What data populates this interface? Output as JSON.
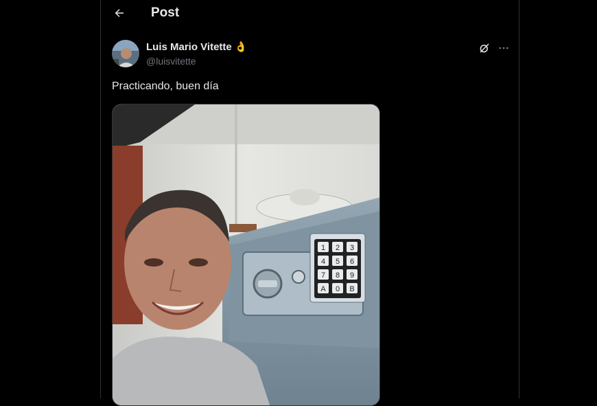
{
  "header": {
    "back_icon": "arrow-left-icon",
    "title": "Post"
  },
  "post": {
    "author": {
      "name": "Luis Mario Vitette",
      "badge": "👌",
      "handle": "@luisvitette"
    },
    "text": "Practicando, buen día",
    "actions": {
      "grok_icon": "grok-icon",
      "more_icon": "more-horizontal-icon"
    },
    "media": {
      "keypad_keys": [
        "1",
        "2",
        "3",
        "4",
        "5",
        "6",
        "7",
        "8",
        "9",
        "A",
        "0",
        "B"
      ]
    }
  },
  "colors": {
    "background": "#000000",
    "text": "#e7e9ea",
    "secondary": "#71767b",
    "border": "#2f3336"
  }
}
